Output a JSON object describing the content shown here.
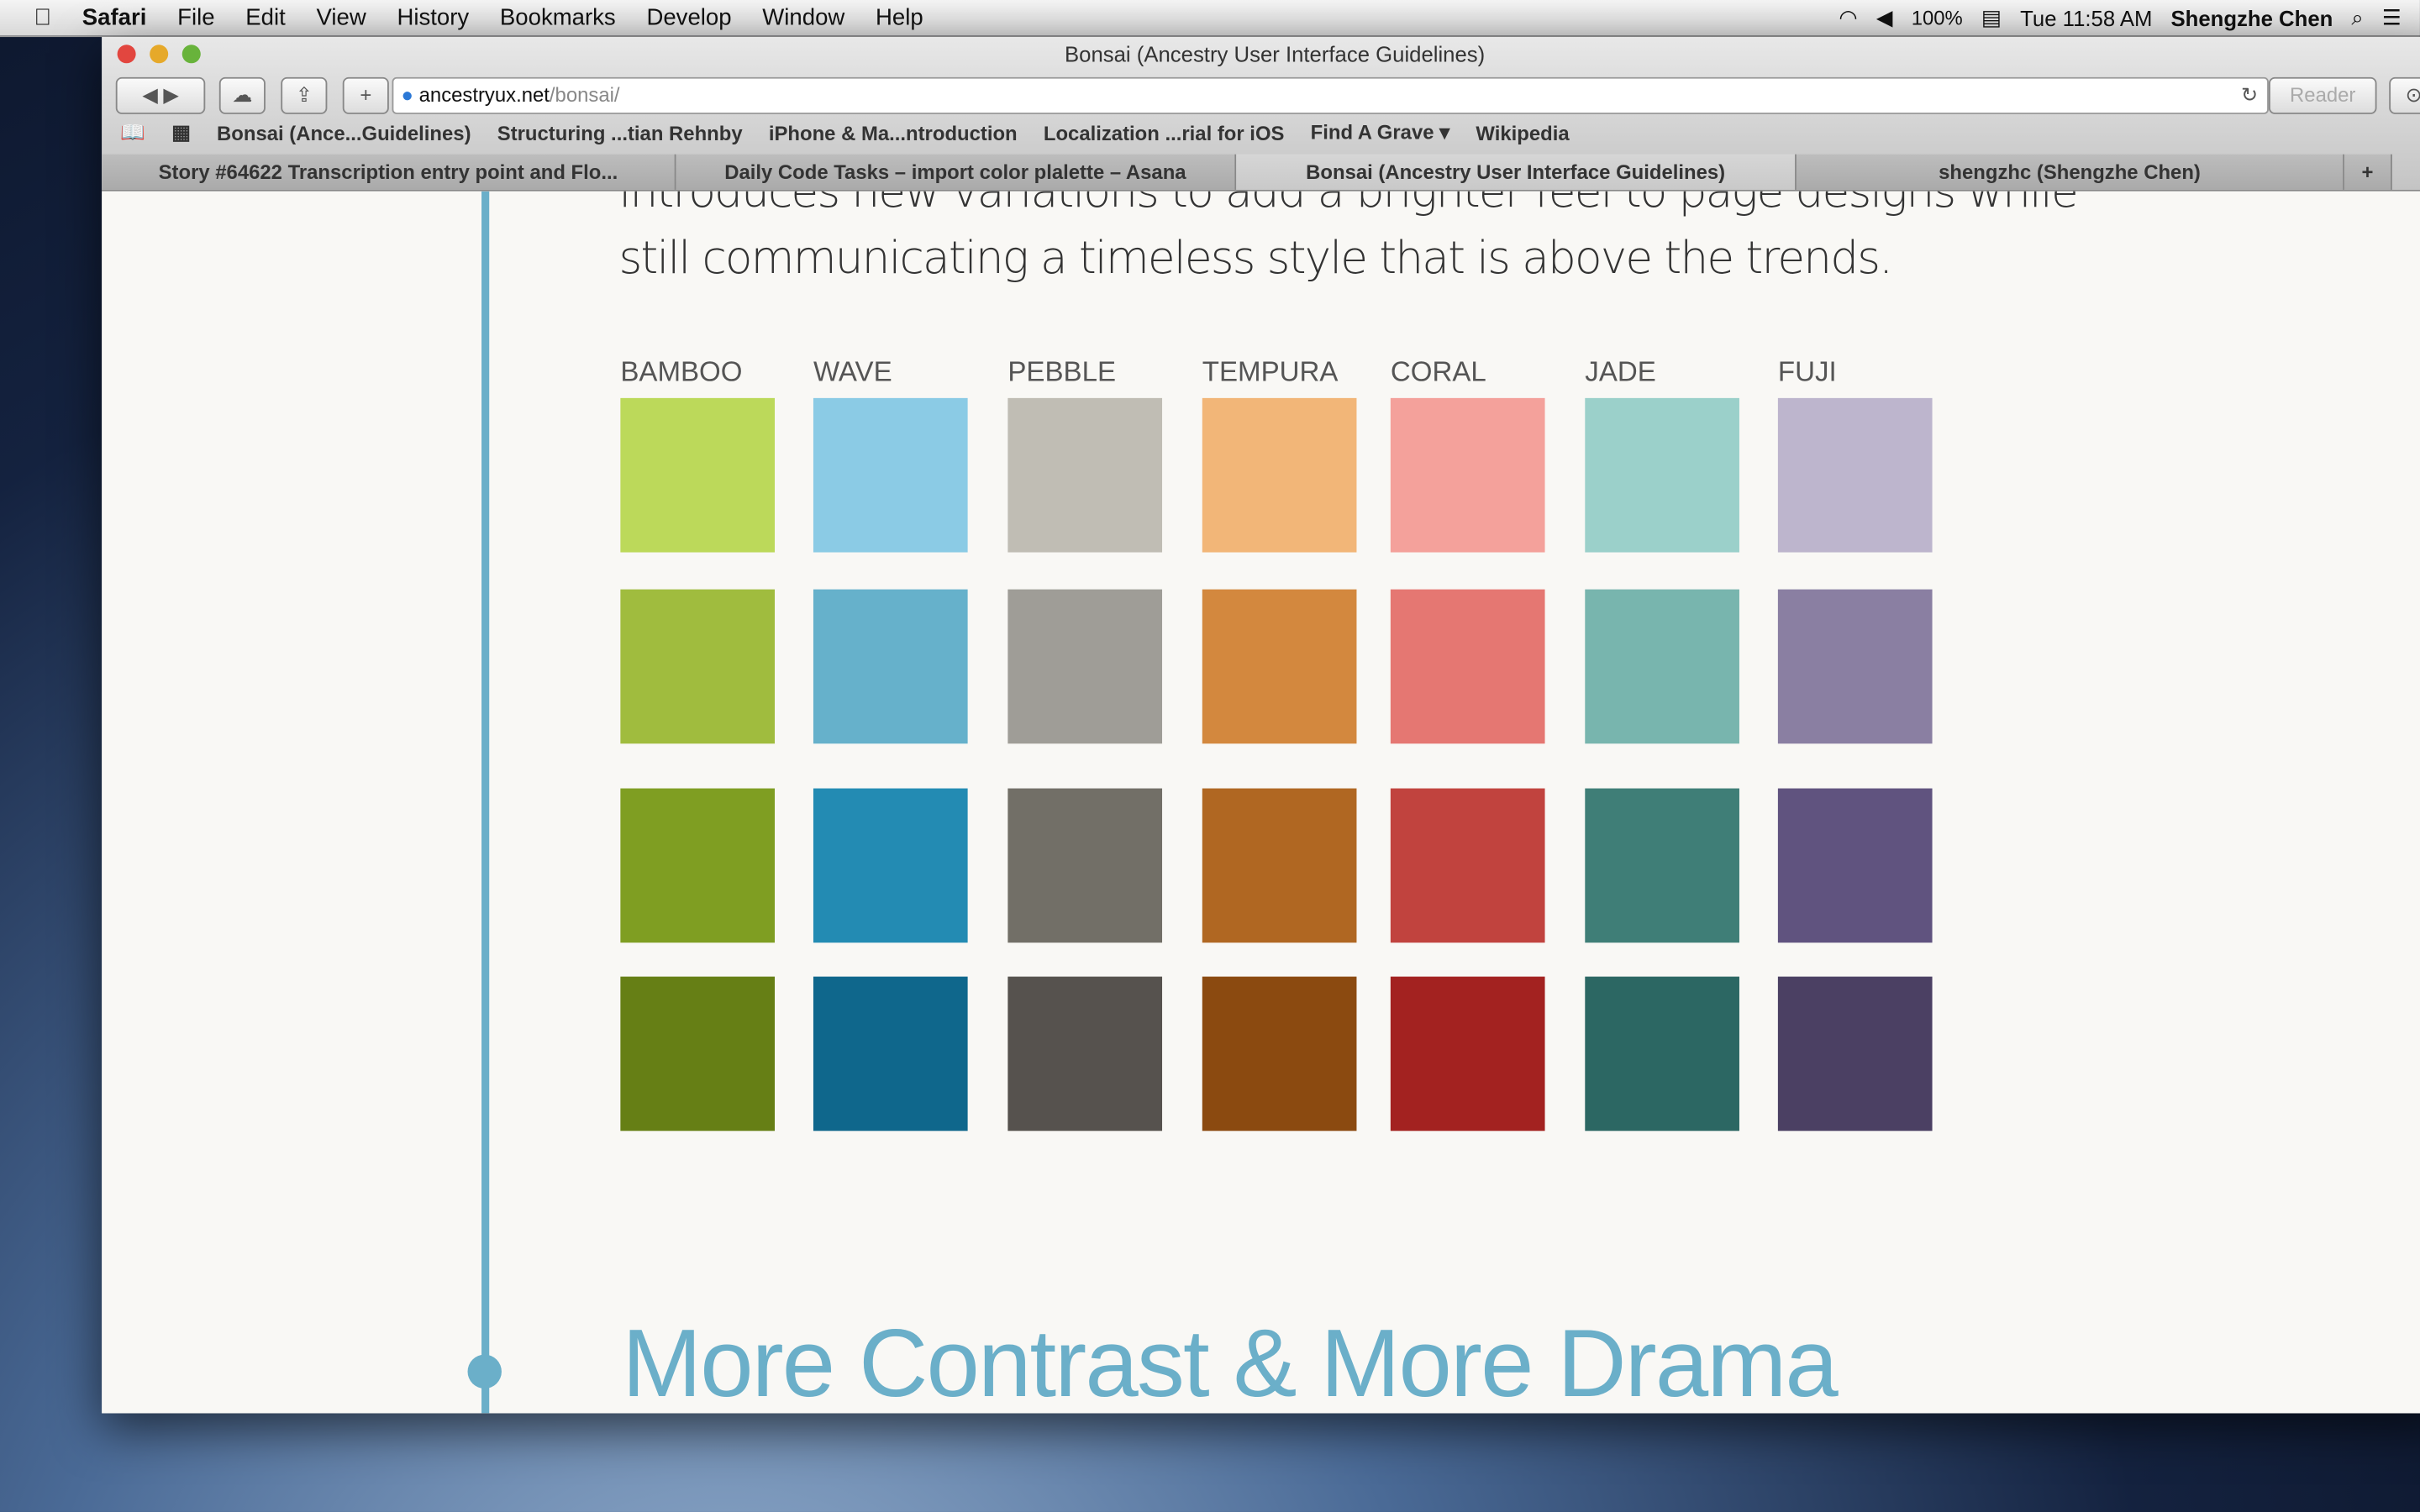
{
  "menubar": {
    "app": "Safari",
    "items": [
      "File",
      "Edit",
      "View",
      "History",
      "Bookmarks",
      "Develop",
      "Window",
      "Help"
    ],
    "battery": "100%",
    "clock": "Tue 11:58 AM",
    "user": "Shengzhe Chen"
  },
  "window": {
    "title": "Bonsai (Ancestry User Interface Guidelines)",
    "url_host": "ancestryux.net",
    "url_path": "/bonsai/",
    "reader": "Reader"
  },
  "bookmarks": [
    "Bonsai (Ance...Guidelines)",
    "Structuring ...tian Rehnby",
    "iPhone & Ma...ntroduction",
    "Localization ...rial for iOS",
    "Find A Grave ▾",
    "Wikipedia"
  ],
  "tabs": [
    "Story #64622 Transcription entry point and Flo...",
    "Daily Code Tasks – import color plalette – Asana",
    "Bonsai (Ancestry User Interface Guidelines)",
    "shengzhc (Shengzhe Chen)"
  ],
  "page": {
    "para_line1": "introduces new variations to add a brighter feel to page designs while",
    "para_line2": "still communicating a timeless style that is above the trends.",
    "heading": "More Contrast & More Drama"
  },
  "palette": [
    {
      "name": "BAMBOO",
      "colors": [
        "#bcd95a",
        "#a0bc3e",
        "#7f9e22",
        "#667f15"
      ]
    },
    {
      "name": "WAVE",
      "colors": [
        "#8bcbe5",
        "#66b1cb",
        "#238bb3",
        "#0f678c"
      ]
    },
    {
      "name": "PEBBLE",
      "colors": [
        "#c0bdb4",
        "#9f9d97",
        "#726f67",
        "#56524e"
      ]
    },
    {
      "name": "TEMPURA",
      "colors": [
        "#f2b678",
        "#d3883e",
        "#b06722",
        "#8b4a10"
      ]
    },
    {
      "name": "CORAL",
      "colors": [
        "#f4a19b",
        "#e57772",
        "#c1433e",
        "#a32220"
      ]
    },
    {
      "name": "JADE",
      "colors": [
        "#9bd0ca",
        "#78b5ae",
        "#3f7e77",
        "#2c6763"
      ]
    },
    {
      "name": "FUJI",
      "colors": [
        "#bdb5cd",
        "#8a7fa2",
        "#60537f",
        "#4b4063"
      ]
    }
  ]
}
